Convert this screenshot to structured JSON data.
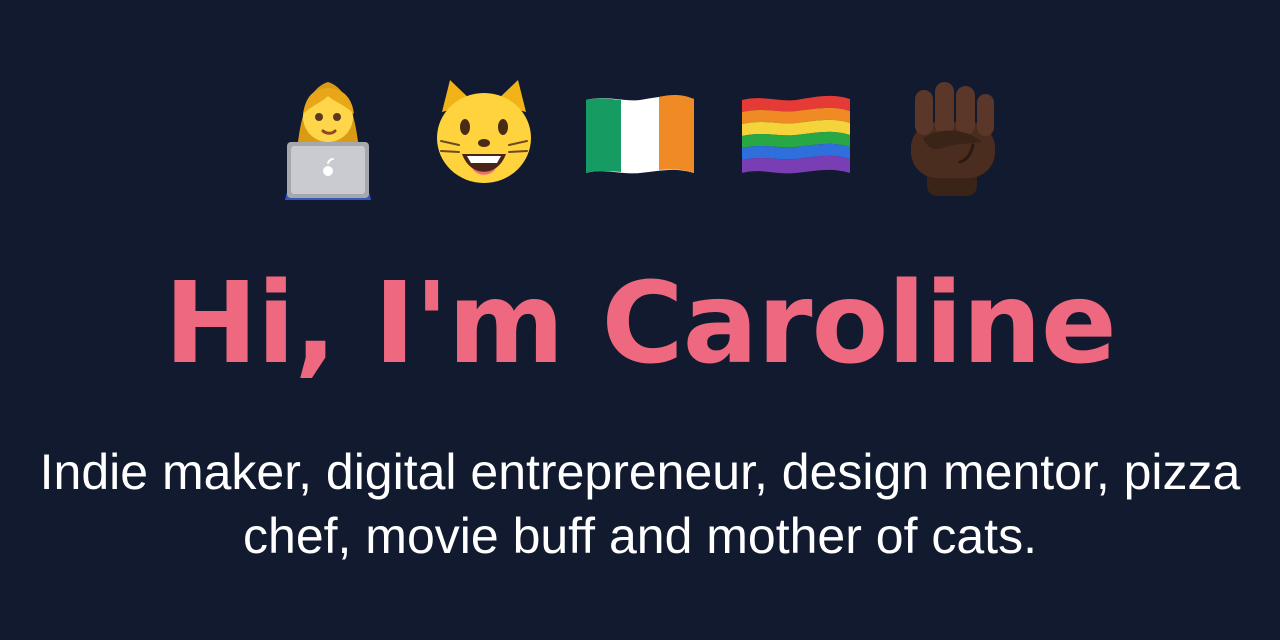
{
  "emojis": [
    {
      "icon": "woman-technologist-icon"
    },
    {
      "icon": "grinning-cat-icon"
    },
    {
      "icon": "ireland-flag-icon"
    },
    {
      "icon": "rainbow-flag-icon"
    },
    {
      "icon": "raised-fist-icon"
    }
  ],
  "hero": {
    "headline": "Hi, I'm Caroline",
    "subtitle": "Indie maker, digital entrepreneur, design mentor, pizza chef, movie buff and mother of cats."
  },
  "colors": {
    "background": "#111a2e",
    "headline": "#ee6880",
    "subtitle": "#ffffff"
  }
}
